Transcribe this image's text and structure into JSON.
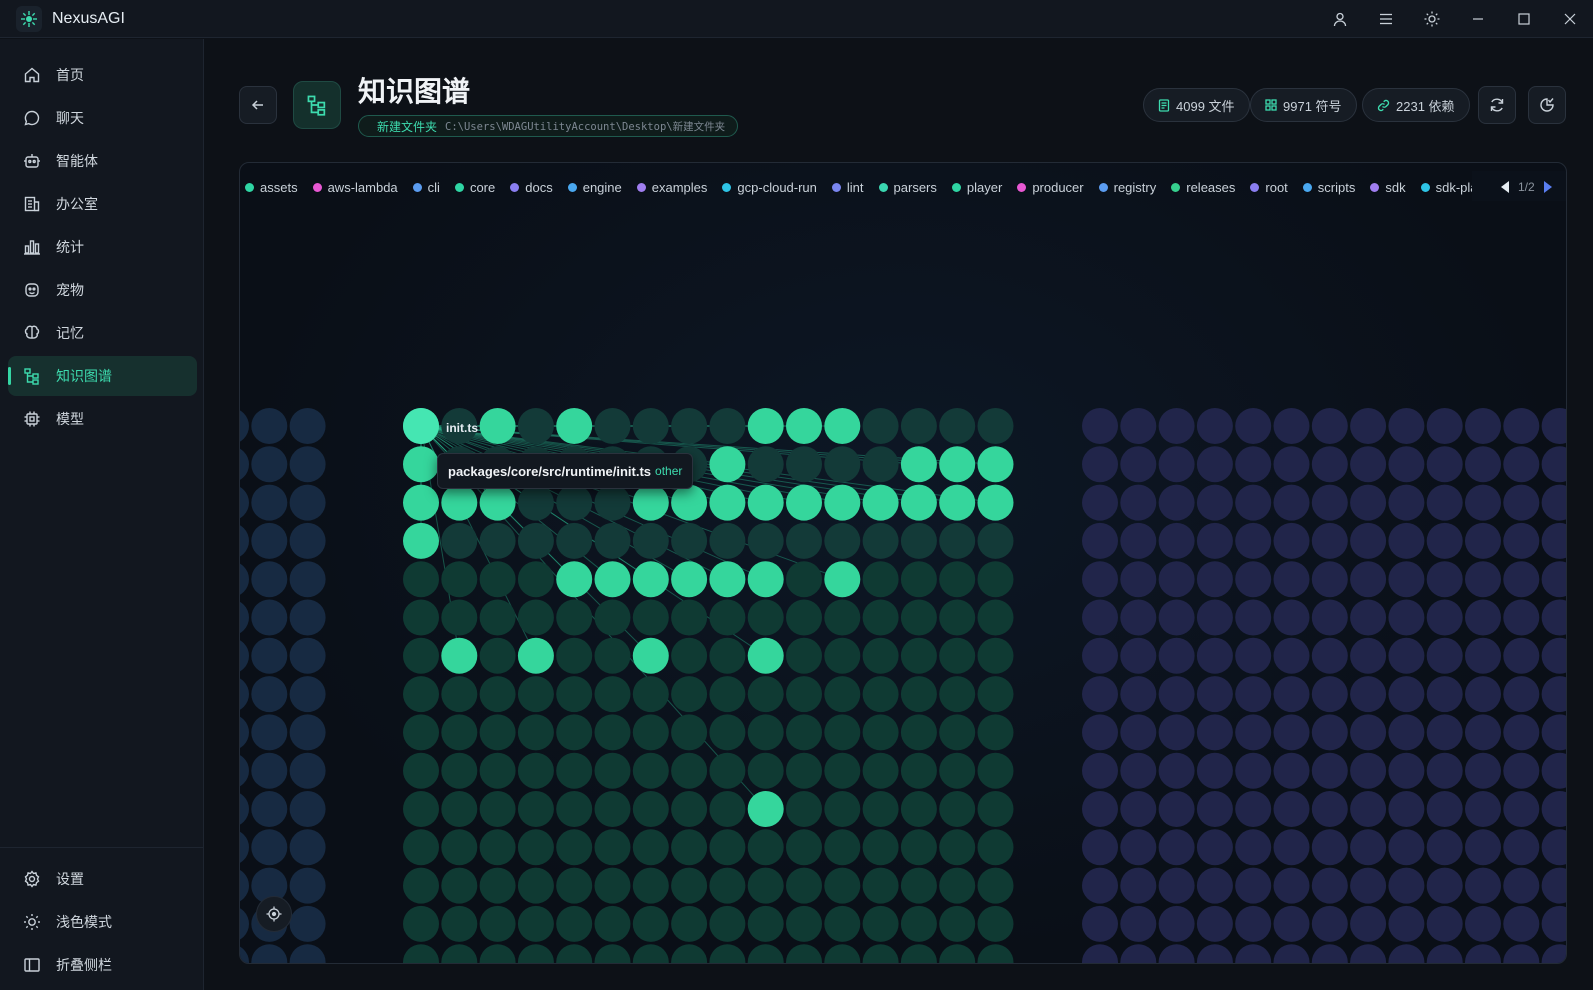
{
  "app": {
    "name": "NexusAGI"
  },
  "titlebar": {
    "icons": [
      "user-icon",
      "menu-icon",
      "sun-icon",
      "minimize-icon",
      "maximize-icon",
      "close-icon"
    ]
  },
  "sidebar": {
    "items": [
      {
        "label": "首页",
        "icon": "home-icon"
      },
      {
        "label": "聊天",
        "icon": "chat-icon"
      },
      {
        "label": "智能体",
        "icon": "robot-icon"
      },
      {
        "label": "办公室",
        "icon": "office-icon"
      },
      {
        "label": "统计",
        "icon": "bar-chart-icon"
      },
      {
        "label": "宠物",
        "icon": "pet-icon"
      },
      {
        "label": "记忆",
        "icon": "brain-icon"
      },
      {
        "label": "知识图谱",
        "icon": "graph-icon",
        "active": true
      },
      {
        "label": "模型",
        "icon": "chip-icon"
      }
    ],
    "bottom": [
      {
        "label": "设置",
        "icon": "gear-icon"
      },
      {
        "label": "浅色模式",
        "icon": "sun-icon"
      },
      {
        "label": "折叠侧栏",
        "icon": "sidebar-collapse-icon"
      }
    ]
  },
  "header": {
    "title": "知识图谱",
    "folder_name": "新建文件夹",
    "folder_path": "C:\\Users\\WDAGUtilityAccount\\Desktop\\新建文件夹",
    "stats": {
      "files": "4099 文件",
      "symbols": "9971 符号",
      "deps": "2231 依赖"
    }
  },
  "legend": {
    "items": [
      {
        "label": "assets",
        "color": "#2fd6a4"
      },
      {
        "label": "aws-lambda",
        "color": "#e858d3"
      },
      {
        "label": "cli",
        "color": "#5b9cf0"
      },
      {
        "label": "core",
        "color": "#2fd6a4"
      },
      {
        "label": "docs",
        "color": "#8a7ef0"
      },
      {
        "label": "engine",
        "color": "#4aa8f0"
      },
      {
        "label": "examples",
        "color": "#a07ef0"
      },
      {
        "label": "gcp-cloud-run",
        "color": "#2ec4e6"
      },
      {
        "label": "lint",
        "color": "#7a86f0"
      },
      {
        "label": "parsers",
        "color": "#3ad6b0"
      },
      {
        "label": "player",
        "color": "#2fd6a4"
      },
      {
        "label": "producer",
        "color": "#e858d3"
      },
      {
        "label": "registry",
        "color": "#5b9cf0"
      },
      {
        "label": "releases",
        "color": "#36d08e"
      },
      {
        "label": "root",
        "color": "#8a7ef0"
      },
      {
        "label": "scripts",
        "color": "#4aa8f0"
      },
      {
        "label": "sdk",
        "color": "#a07ef0"
      },
      {
        "label": "sdk-playg",
        "color": "#2ec4e6"
      }
    ],
    "page": "1/2"
  },
  "graph": {
    "hovered_label": "init.ts",
    "tooltip_path": "packages/core/src/runtime/init.ts",
    "tooltip_kind": "other"
  }
}
